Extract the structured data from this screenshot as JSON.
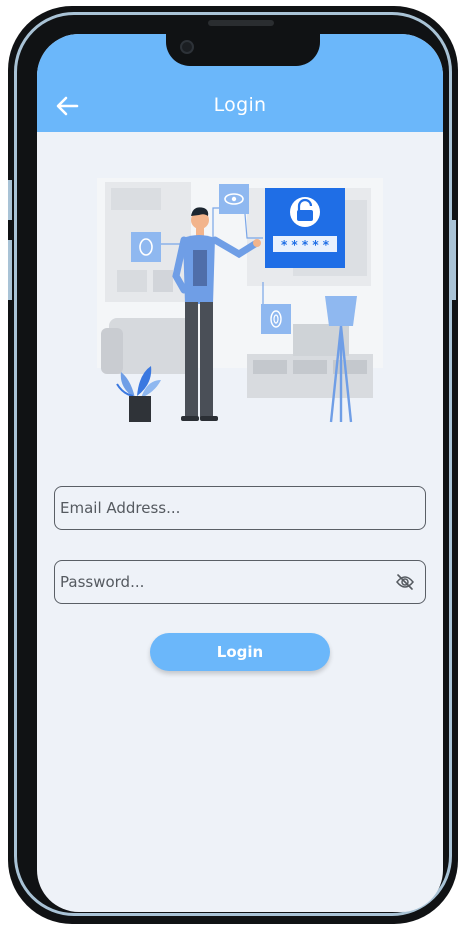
{
  "appbar": {
    "title": "Login",
    "back_icon": "arrow-left-icon",
    "background": "#6bb7fa"
  },
  "illustration": {
    "password_mask": "* * * * *",
    "icons": [
      "eye-icon",
      "face-scan-icon",
      "padlock-icon",
      "fingerprint-icon",
      "plant-icon",
      "floor-lamp-icon"
    ]
  },
  "form": {
    "email_placeholder": "Email Address...",
    "password_placeholder": "Password...",
    "visibility_icon": "eye-off-icon",
    "login_label": "Login"
  },
  "colors": {
    "accent": "#6bb7fa",
    "screen_bg": "#eef2f8",
    "panel_blue": "#1f6ee6"
  }
}
